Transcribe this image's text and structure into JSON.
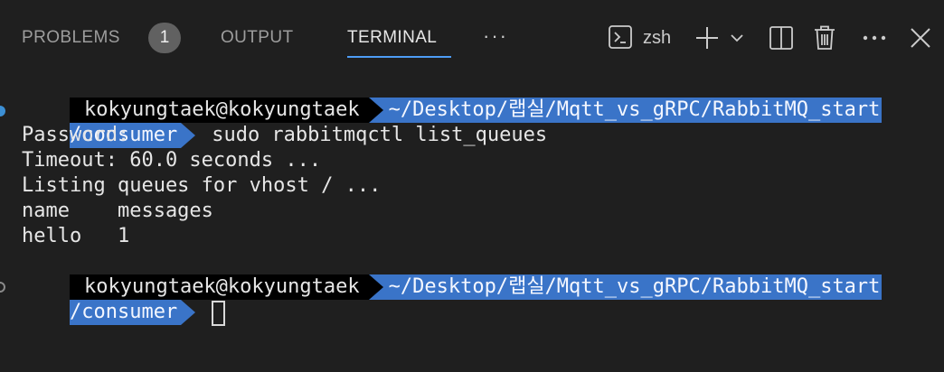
{
  "panel": {
    "tabs": [
      {
        "label": "PROBLEMS",
        "badge": "1"
      },
      {
        "label": "OUTPUT"
      },
      {
        "label": "TERMINAL"
      }
    ],
    "more_tabs": "···",
    "shell_name": "zsh",
    "colors": {
      "accent": "#4d9cf5",
      "prompt_path_bg": "#3a74c8",
      "prompt_user_bg": "#000000",
      "background": "#1f1f1f"
    },
    "icons": [
      "terminal-icon",
      "plus-icon",
      "chevron-down-icon",
      "split-icon",
      "trash-icon",
      "ellipsis-icon",
      "close-icon"
    ]
  },
  "terminal": {
    "prompt1": {
      "user": "kokyungtaek@kokyungtaek",
      "path_line1": "~/Desktop/랩실/Mqtt_vs_gRPC/RabbitMQ_start",
      "path_line2": "/consumer",
      "command": "sudo rabbitmqctl list_queues"
    },
    "output": [
      "Password:",
      "Timeout: 60.0 seconds ...",
      "Listing queues for vhost / ...",
      "name    messages",
      "hello   1"
    ],
    "prompt2": {
      "user": "kokyungtaek@kokyungtaek",
      "path_line1": "~/Desktop/랩실/Mqtt_vs_gRPC/RabbitMQ_start",
      "path_line2": "/consumer",
      "command": ""
    }
  }
}
